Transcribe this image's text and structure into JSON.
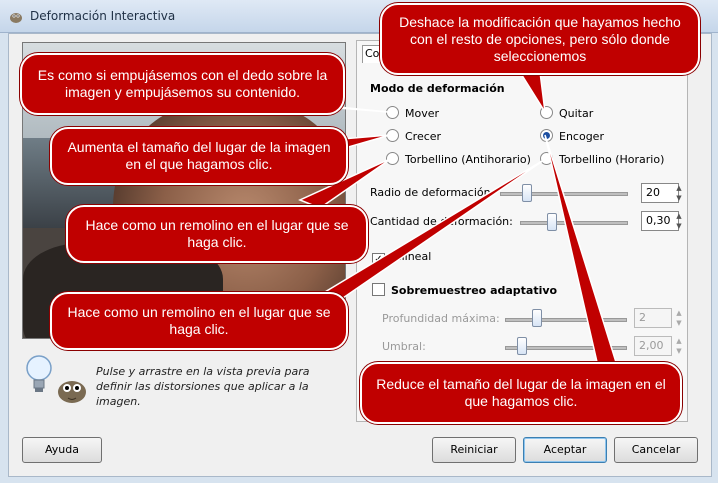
{
  "window": {
    "title": "Deformación Interactiva",
    "app_icon": "gimp-wilber-icon"
  },
  "preview": {
    "hint": "Pulse y arrastre en la vista previa para definir las distorsiones que aplicar a la imagen."
  },
  "tab": {
    "label": "Co"
  },
  "deform_mode": {
    "title": "Modo de deformación",
    "options": [
      {
        "label": "Mover",
        "selected": false
      },
      {
        "label": "Quitar",
        "selected": false
      },
      {
        "label": "Crecer",
        "selected": false
      },
      {
        "label": "Encoger",
        "selected": true
      },
      {
        "label": "Torbellino (Antihorario)",
        "selected": false
      },
      {
        "label": "Torbellino (Horario)",
        "selected": false
      }
    ]
  },
  "settings": {
    "radius_label": "Radio de deformación:",
    "radius_value": "20",
    "amount_label": "Cantidad de deformación:",
    "amount_value": "0,30",
    "bilinear_label": "Bilineal",
    "bilinear_checked": true,
    "adaptive_label": "Sobremuestreo adaptativo",
    "adaptive_checked": false,
    "depth_label": "Profundidad máxima:",
    "depth_value": "2",
    "threshold_label": "Umbral:",
    "threshold_value": "2,00"
  },
  "buttons": {
    "help": "Ayuda",
    "reset": "Reiniciar",
    "ok": "Aceptar",
    "cancel": "Cancelar"
  },
  "callouts": {
    "mover": "Es como si empujásemos con el dedo sobre la imagen y empujásemos su contenido.",
    "quitar": "Deshace la modificación que hayamos hecho con el resto de opciones, pero sólo donde seleccionemos",
    "crecer": "Aumenta el tamaño del lugar de la imagen en el que hagamos clic.",
    "torbellino_anti": "Hace como un remolino en el lugar que se haga clic.",
    "torbellino_hor": "Hace como un remolino en el lugar que se haga clic.",
    "encoger": "Reduce el tamaño del lugar de la imagen en el que hagamos clic."
  },
  "colors": {
    "callout_bg": "#c00000",
    "titlebar": "#c5d6ea",
    "selected_radio": "#1c4fa1"
  }
}
